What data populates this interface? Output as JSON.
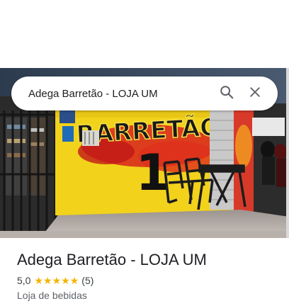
{
  "search": {
    "query": "Adega Barretão - LOJA UM"
  },
  "place": {
    "name": "Adega Barretão - LOJA UM",
    "rating": "5,0",
    "stars": 5,
    "review_count": "(5)",
    "category": "Loja de bebidas"
  },
  "photo": {
    "sign_text": "BARRETÃO",
    "sign_number": "1"
  },
  "colors": {
    "star": "#f4b400",
    "wall_yellow": "#f2d21b",
    "graffiti_red": "#d8231d",
    "title_text": "#202124",
    "icon": "#5f6368"
  },
  "icons": {
    "search": "search-icon",
    "close": "close-icon",
    "star": "star-icon"
  }
}
